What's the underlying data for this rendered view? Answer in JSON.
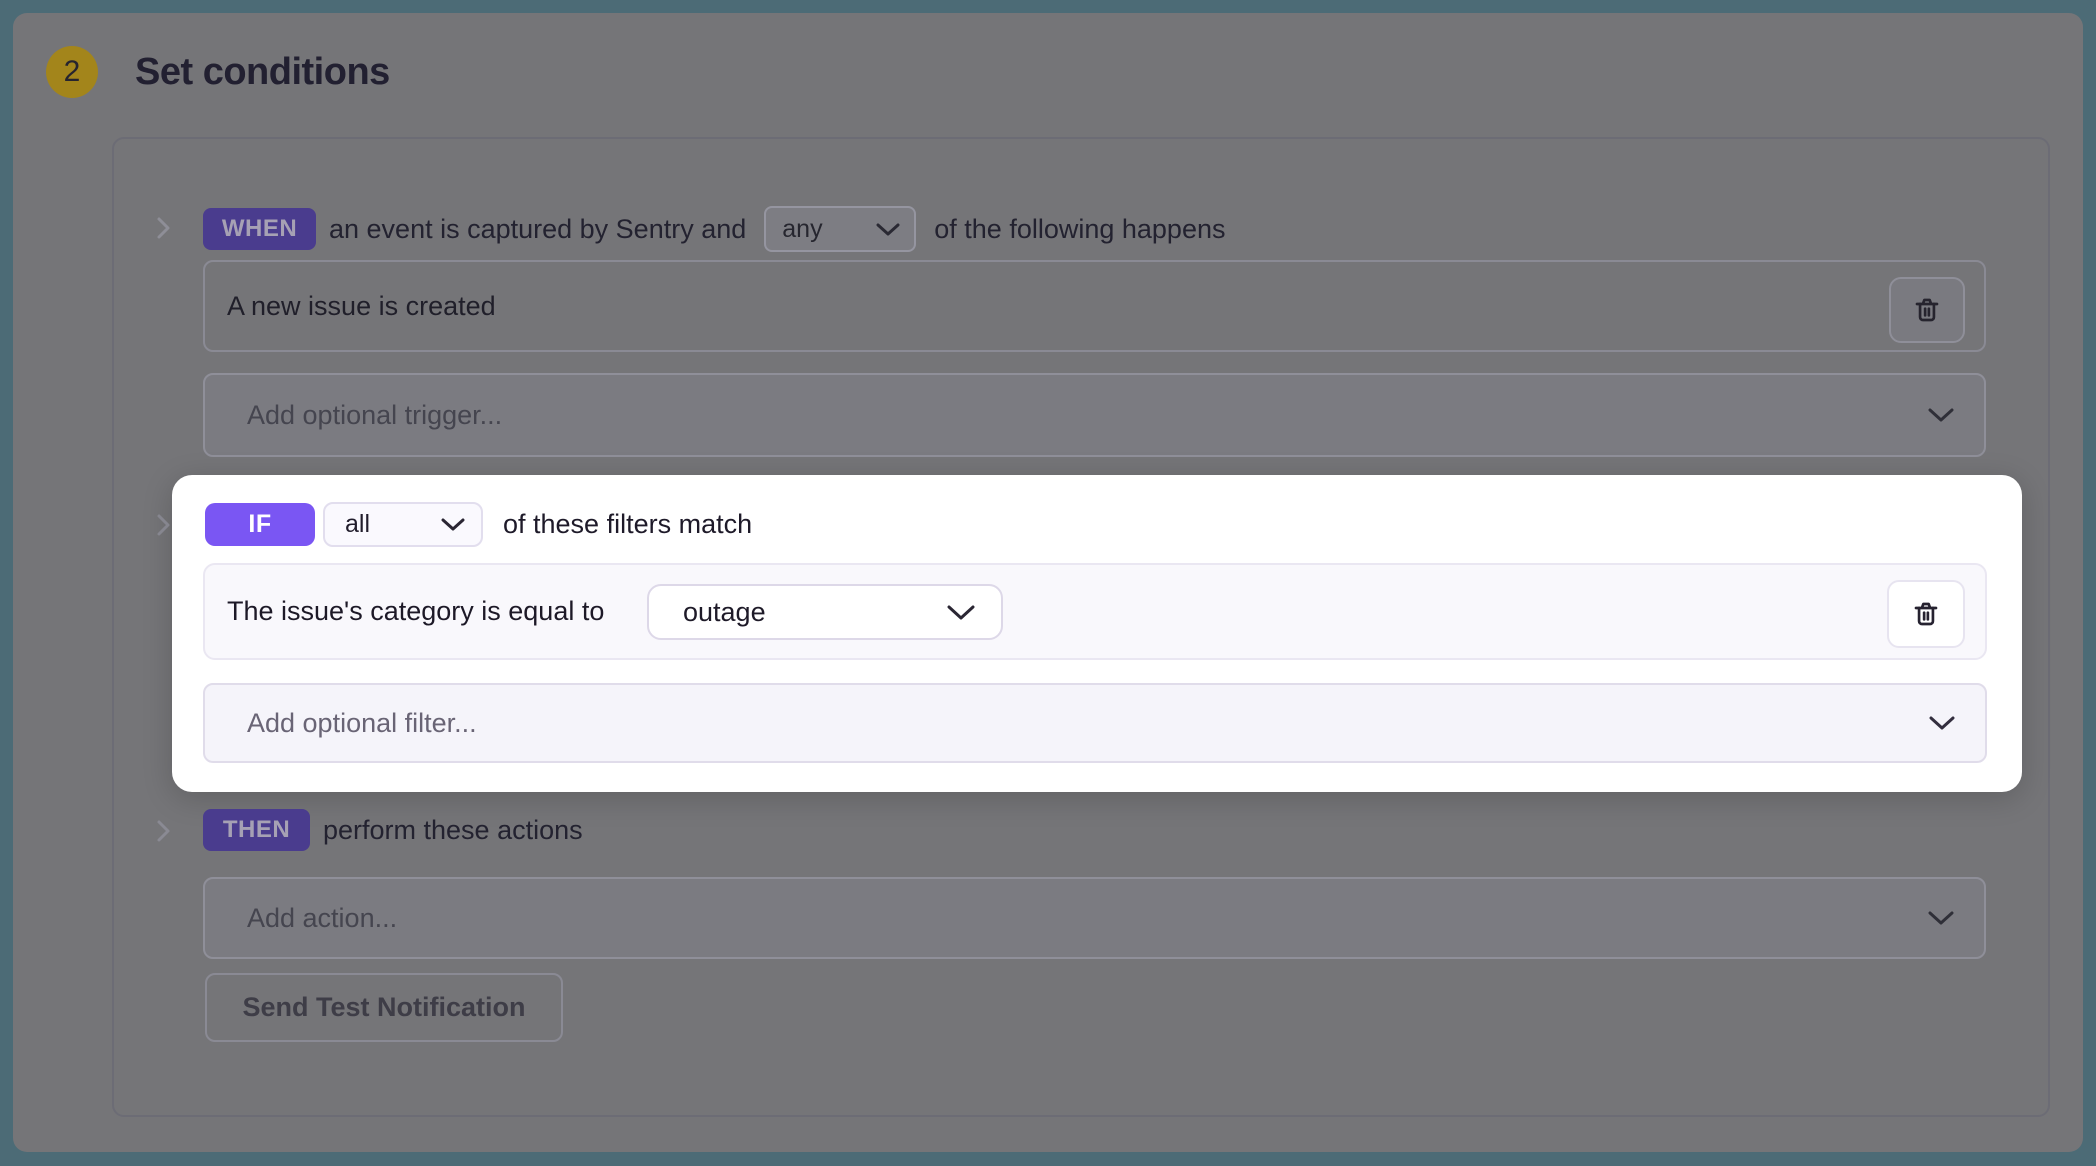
{
  "header": {
    "step_number": "2",
    "title": "Set conditions"
  },
  "when_section": {
    "badge_label": "WHEN",
    "text_before_select": "an event is captured by Sentry and",
    "match_select_value": "any",
    "text_after_select": "of the following happens",
    "trigger_row_label": "A new issue is created",
    "add_row_placeholder": "Add optional trigger..."
  },
  "if_section": {
    "badge_label": "IF",
    "match_select_value": "all",
    "text_after_select": "of these filters match",
    "filter_row_label": "The issue's category is equal to",
    "filter_select_value": "outage",
    "add_row_placeholder": "Add optional filter..."
  },
  "then_section": {
    "badge_label": "THEN",
    "text_after_badge": "perform these actions",
    "add_row_placeholder": "Add action...",
    "test_button_label": "Send Test Notification"
  },
  "colors": {
    "accent_purple": "#7A56F3",
    "step_badge_gold": "#A3851B",
    "frame_teal": "#4C6B76",
    "overlay_gray": "#757578"
  },
  "icons": {
    "delete": "trash-icon",
    "open_select": "chevron-down-icon",
    "collapse_section": "chevron-right-icon"
  }
}
